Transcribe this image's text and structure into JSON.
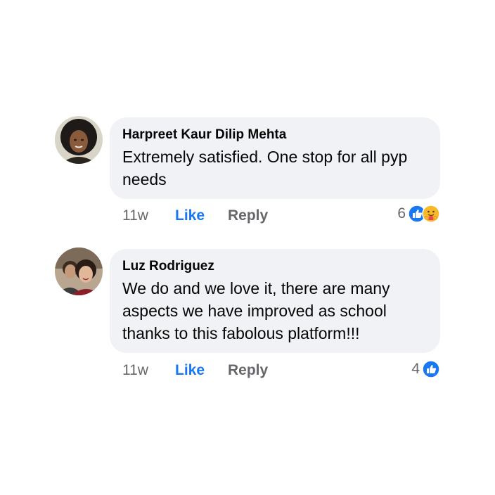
{
  "comments": [
    {
      "author": "Harpreet Kaur Dilip Mehta",
      "text": "Extremely satisfied. One stop for all pyp needs",
      "time": "11w",
      "like_label": "Like",
      "reply_label": "Reply",
      "reaction_count": "6",
      "reactions": [
        "like-icon",
        "care-icon"
      ]
    },
    {
      "author": "Luz Rodriguez",
      "text": "We do and we love it, there are many aspects we have improved as school thanks to this fabolous platform!!!",
      "time": "11w",
      "like_label": "Like",
      "reply_label": "Reply",
      "reaction_count": "4",
      "reactions": [
        "like-icon"
      ]
    }
  ],
  "colors": {
    "accent": "#1877f2",
    "bubble": "#f0f2f5",
    "muted": "#65676b"
  }
}
